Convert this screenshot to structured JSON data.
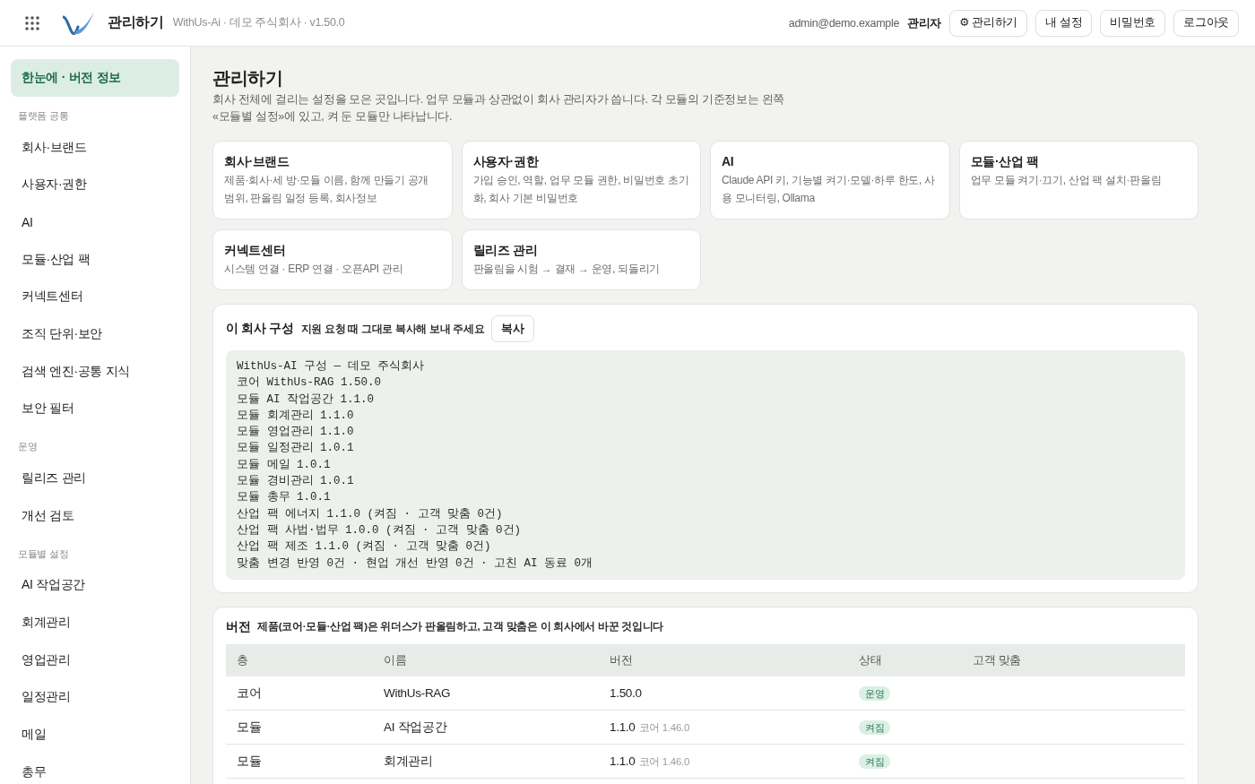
{
  "header": {
    "app_title": "관리하기",
    "subtitle": "WithUs-Ai · 데모 주식회사 · v1.50.0",
    "user_email": "admin@demo.example",
    "role": "관리자",
    "buttons": [
      {
        "label": "⚙ 관리하기"
      },
      {
        "label": "내 설정"
      },
      {
        "label": "비밀번호"
      },
      {
        "label": "로그아웃"
      }
    ]
  },
  "sidebar": {
    "sections": [
      {
        "items": [
          {
            "label": "한눈에 · 버전 정보",
            "selected": true
          }
        ]
      },
      {
        "heading": "플랫폼 공통",
        "items": [
          {
            "label": "회사·브랜드",
            "selected": false
          },
          {
            "label": "사용자·권한",
            "selected": false
          },
          {
            "label": "AI",
            "selected": false
          },
          {
            "label": "모듈·산업 팩",
            "selected": false
          },
          {
            "label": "커넥트센터",
            "selected": false
          },
          {
            "label": "조직 단위·보안",
            "selected": false
          },
          {
            "label": "검색 엔진·공통 지식",
            "selected": false
          },
          {
            "label": "보안 필터",
            "selected": false
          }
        ]
      },
      {
        "heading": "운영",
        "items": [
          {
            "label": "릴리즈 관리",
            "selected": false
          },
          {
            "label": "개선 검토",
            "selected": false
          }
        ]
      },
      {
        "heading": "모듈별 설정",
        "items": [
          {
            "label": "AI 작업공간",
            "selected": false
          },
          {
            "label": "회계관리",
            "selected": false
          },
          {
            "label": "영업관리",
            "selected": false
          },
          {
            "label": "일정관리",
            "selected": false
          },
          {
            "label": "메일",
            "selected": false
          },
          {
            "label": "총무",
            "selected": false
          }
        ]
      }
    ]
  },
  "page": {
    "title": "관리하기",
    "description": "회사 전체에 걸리는 설정을 모은 곳입니다. 업무 모듈과 상관없이 회사 관리자가 씁니다. 각 모듈의 기준정보는 왼쪽 «모듈별 설정»에 있고, 켜 둔 모듈만 나타납니다."
  },
  "cards": [
    {
      "title": "회사·브랜드",
      "description": "제품·회사·세 방·모듈 이름, 함께 만들기 공개 범위, 판올림 일정 등록, 회사정보"
    },
    {
      "title": "사용자·권한",
      "description": "가입 승인, 역할, 업무 모듈 권한, 비밀번호 초기화, 회사 기본 비밀번호"
    },
    {
      "title": "AI",
      "description": "Claude API 키, 기능별 켜기·모델·하루 한도, 사용 모니터링, Ollama"
    },
    {
      "title": "모듈·산업 팩",
      "description": "업무 모듈 켜기·끄기, 산업 팩 설치·판올림"
    },
    {
      "title": "커넥트센터",
      "description": "시스템 연결 · ERP 연결 · 오픈API 관리"
    },
    {
      "title": "릴리즈 관리",
      "description": "판올림을 시험 → 결재 → 운영, 되돌리기"
    }
  ],
  "config": {
    "title": "이 회사 구성",
    "hint": "지원 요청 때 그대로 복사해 보내 주세요",
    "copy_button": "복사",
    "lines": [
      "WithUs-AI 구성 — 데모 주식회사",
      "코어 WithUs-RAG 1.50.0",
      "모듈 AI 작업공간 1.1.0",
      "모듈 회계관리 1.1.0",
      "모듈 영업관리 1.1.0",
      "모듈 일정관리 1.0.1",
      "모듈 메일 1.0.1",
      "모듈 경비관리 1.0.1",
      "모듈 총무 1.0.1",
      "산업 팩 에너지 1.1.0 (켜짐 · 고객 맞춤 0건)",
      "산업 팩 사법·법무 1.0.0 (켜짐 · 고객 맞춤 0건)",
      "산업 팩 제조 1.1.0 (켜짐 · 고객 맞춤 0건)",
      "맞춤 변경 반영 0건 · 현업 개선 반영 0건 · 고친 AI 동료 0개"
    ]
  },
  "versions": {
    "title": "버전",
    "hint": "제품(코어·모듈·산업 팩)은 위더스가 판올림하고, 고객 맞춤은 이 회사에서 바꾼 것입니다",
    "columns": [
      "층",
      "이름",
      "버전",
      "상태",
      "고객 맞춤"
    ],
    "rows": [
      {
        "layer": "코어",
        "name": "WithUs-RAG",
        "version": "1.50.0",
        "status": "운영"
      },
      {
        "layer": "모듈",
        "name": "AI 작업공간",
        "version": "1.1.0",
        "requires": "코어 1.46.0",
        "status": "켜짐"
      },
      {
        "layer": "모듈",
        "name": "회계관리",
        "version": "1.1.0",
        "requires": "코어 1.46.0",
        "status": "켜짐"
      }
    ]
  }
}
